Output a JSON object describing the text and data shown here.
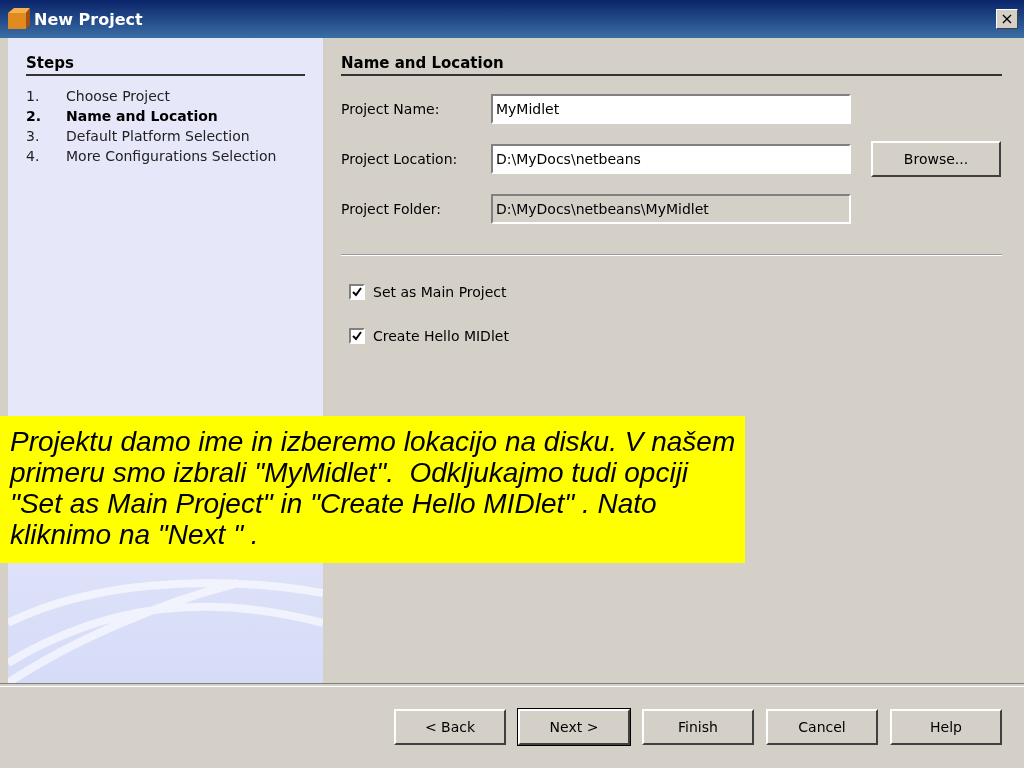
{
  "window": {
    "title": "New Project",
    "close": "×"
  },
  "steps": {
    "heading": "Steps",
    "items": [
      {
        "number": "1.",
        "label": "Choose Project",
        "selected": false
      },
      {
        "number": "2.",
        "label": "Name and Location",
        "selected": true
      },
      {
        "number": "3.",
        "label": "Default Platform Selection",
        "selected": false
      },
      {
        "number": "4.",
        "label": "More Configurations Selection",
        "selected": false
      }
    ]
  },
  "panel": {
    "heading": "Name and Location",
    "fields": [
      {
        "label": "Project Name:",
        "value": "MyMidlet",
        "disabled": false
      },
      {
        "label": "Project Location:",
        "value": "D:\\MyDocs\\netbeans",
        "disabled": false,
        "button": "Browse..."
      },
      {
        "label": "Project Folder:",
        "value": "D:\\MyDocs\\netbeans\\MyMidlet",
        "disabled": true
      }
    ],
    "checkboxes": [
      {
        "label": "Set as Main Project",
        "checked": true
      },
      {
        "label": "Create Hello MIDlet",
        "checked": true
      }
    ]
  },
  "callout": {
    "text": "Projektu damo ime in izberemo lokacijo na disku. V našem primeru smo izbrali \"MyMidlet\".  Odkljukajmo tudi opciji \"Set as Main Project\" in \"Create Hello MIDlet\" . Nato kliknimo na \"Next \" ."
  },
  "buttons": [
    {
      "label": "< Back",
      "default": false
    },
    {
      "label": "Next >",
      "default": true
    },
    {
      "label": "Finish",
      "default": false
    },
    {
      "label": "Cancel",
      "default": false
    },
    {
      "label": "Help",
      "default": false
    }
  ]
}
